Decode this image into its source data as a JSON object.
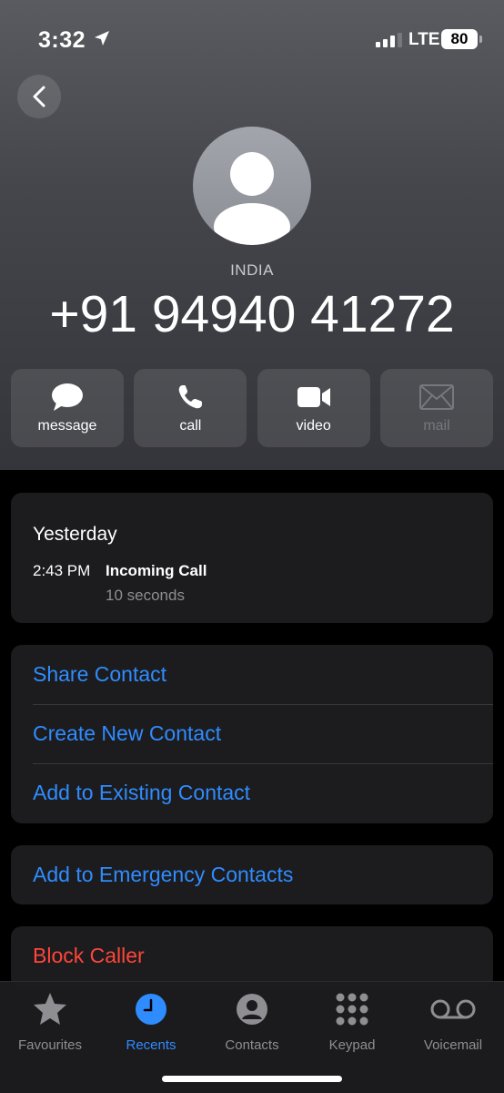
{
  "status": {
    "time": "3:32",
    "network": "LTE",
    "battery": "80"
  },
  "contact": {
    "country": "INDIA",
    "number": "+91 94940 41272"
  },
  "actions": [
    {
      "label": "message"
    },
    {
      "label": "call"
    },
    {
      "label": "video"
    },
    {
      "label": "mail"
    }
  ],
  "history": {
    "day": "Yesterday",
    "time": "2:43 PM",
    "type": "Incoming Call",
    "duration": "10 seconds"
  },
  "options": {
    "share": "Share Contact",
    "create": "Create New Contact",
    "add_existing": "Add to Existing Contact",
    "emergency": "Add to Emergency Contacts",
    "block": "Block Caller"
  },
  "tabs": [
    {
      "label": "Favourites"
    },
    {
      "label": "Recents"
    },
    {
      "label": "Contacts"
    },
    {
      "label": "Keypad"
    },
    {
      "label": "Voicemail"
    }
  ],
  "colors": {
    "accent": "#2f8cff",
    "danger": "#ff453a",
    "card": "#1c1c1e"
  }
}
